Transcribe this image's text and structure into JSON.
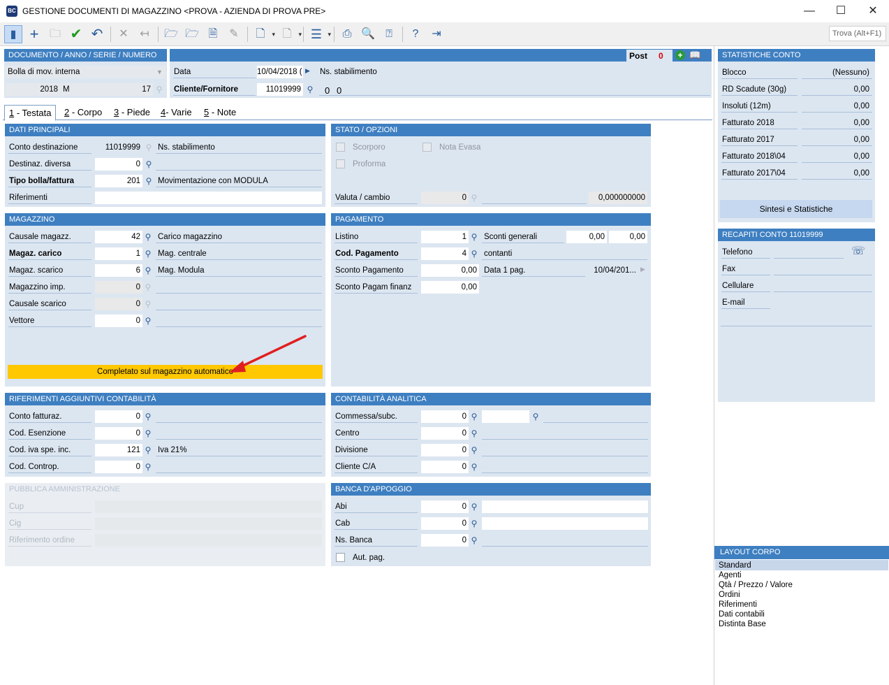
{
  "window": {
    "title": "GESTIONE DOCUMENTI DI MAGAZZINO <PROVA - AZIENDA DI PROVA PRE>",
    "app_icon_text": "BC",
    "minimize": "—",
    "maximize": "☐",
    "close": "✕"
  },
  "toolbar": {
    "find_placeholder": "Trova (Alt+F1)"
  },
  "doc_header": {
    "title": "DOCUMENTO / ANNO / SERIE / NUMERO",
    "doc_type": "Bolla di mov. interna",
    "year": "2018",
    "series": "M",
    "number": "17"
  },
  "top_panel": {
    "post_label": "Post",
    "post_value": "0",
    "date_label": "Data",
    "date_value": "10/04/2018 (",
    "ns_stabilimento": "Ns. stabilimento",
    "cliente_label": "Cliente/Fornitore",
    "cliente_value": "11019999",
    "zero_a": "0",
    "zero_b": "0"
  },
  "tabs": [
    {
      "key": "1",
      "label": " - Testata"
    },
    {
      "key": "2",
      "label": " - Corpo"
    },
    {
      "key": "3",
      "label": " - Piede"
    },
    {
      "key": "4",
      "label": "- Varie"
    },
    {
      "key": "5",
      "label": " - Note"
    }
  ],
  "dati_principali": {
    "title": "DATI PRINCIPALI",
    "conto_destinazione_label": "Conto destinazione",
    "conto_destinazione_value": "11019999",
    "conto_destinazione_desc": "Ns. stabilimento",
    "destinaz_label": "Destinaz. diversa",
    "destinaz_value": "0",
    "tipo_bolla_label": "Tipo bolla/fattura",
    "tipo_bolla_value": "201",
    "tipo_bolla_desc": "Movimentazione con MODULA",
    "riferimenti_label": "Riferimenti"
  },
  "stato_opzioni": {
    "title": "STATO / OPZIONI",
    "scorporo": "Scorporo",
    "nota_evasa": "Nota Evasa",
    "proforma": "Proforma",
    "valuta_label": "Valuta / cambio",
    "valuta_value": "0",
    "cambio_value": "0,000000000"
  },
  "magazzino": {
    "title": "MAGAZZINO",
    "rows": [
      {
        "label": "Causale magazz.",
        "value": "42",
        "desc": "Carico magazzino",
        "bold": false,
        "ro": false
      },
      {
        "label": "Magaz. carico",
        "value": "1",
        "desc": "Mag. centrale",
        "bold": true,
        "ro": false
      },
      {
        "label": "Magaz. scarico",
        "value": "6",
        "desc": "Mag. Modula",
        "bold": false,
        "ro": false
      },
      {
        "label": "Magazzino imp.",
        "value": "0",
        "desc": "",
        "bold": false,
        "ro": true
      },
      {
        "label": "Causale scarico",
        "value": "0",
        "desc": "",
        "bold": false,
        "ro": true
      },
      {
        "label": "Vettore",
        "value": "0",
        "desc": "",
        "bold": false,
        "ro": false
      }
    ],
    "status_bar": "Completato sul magazzino automatico"
  },
  "pagamento": {
    "title": "PAGAMENTO",
    "listino_label": "Listino",
    "listino_value": "1",
    "sconti_generali_label": "Sconti generali",
    "sconto_1": "0,00",
    "sconto_2": "0,00",
    "cod_pag_label": "Cod. Pagamento",
    "cod_pag_value": "4",
    "cod_pag_desc": "contanti",
    "sconto_pag_label": "Sconto Pagamento",
    "sconto_pag_value": "0,00",
    "data_1_pag_label": "Data 1 pag.",
    "data_1_pag_value": "10/04/201...",
    "sconto_finanz_label": "Sconto Pagam finanz",
    "sconto_finanz_value": "0,00"
  },
  "rif_contabilita": {
    "title": "RIFERIMENTI AGGIUNTIVI CONTABILITÀ",
    "rows": [
      {
        "label": "Conto fatturaz.",
        "value": "0",
        "desc": ""
      },
      {
        "label": "Cod. Esenzione",
        "value": "0",
        "desc": ""
      },
      {
        "label": "Cod. iva spe. inc.",
        "value": "121",
        "desc": "Iva 21%"
      },
      {
        "label": "Cod. Controp.",
        "value": "0",
        "desc": ""
      }
    ]
  },
  "contabilita_analitica": {
    "title": "CONTABILITÀ ANALITICA",
    "rows": [
      {
        "label": "Commessa/subc.",
        "value": "0"
      },
      {
        "label": "Centro",
        "value": "0"
      },
      {
        "label": "Divisione",
        "value": "0"
      },
      {
        "label": "Cliente C/A",
        "value": "0"
      }
    ]
  },
  "pubblica_amm": {
    "title": "PUBBLICA AMMINISTRAZIONE",
    "rows": [
      "Cup",
      "Cig",
      "Riferimento ordine"
    ]
  },
  "banca": {
    "title": "BANCA D'APPOGGIO",
    "rows": [
      {
        "label": "Abi",
        "value": "0"
      },
      {
        "label": "Cab",
        "value": "0"
      },
      {
        "label": "Ns. Banca",
        "value": "0"
      }
    ],
    "aut_pag": "Aut. pag."
  },
  "statistiche": {
    "title": "STATISTICHE CONTO",
    "rows": [
      {
        "label": "Blocco",
        "value": "(Nessuno)"
      },
      {
        "label": "RD Scadute (30g)",
        "value": "0,00"
      },
      {
        "label": "Insoluti (12m)",
        "value": "0,00"
      },
      {
        "label": "Fatturato 2018",
        "value": "0,00"
      },
      {
        "label": "Fatturato 2017",
        "value": "0,00"
      },
      {
        "label": "Fatturato 2018\\04",
        "value": "0,00"
      },
      {
        "label": "Fatturato 2017\\04",
        "value": "0,00"
      }
    ],
    "button": "Sintesi e Statistiche"
  },
  "recapiti": {
    "title": "RECAPITI CONTO 11019999",
    "rows": [
      "Telefono",
      "Fax",
      "Cellulare",
      "E-mail"
    ]
  },
  "layout_corpo": {
    "title": "LAYOUT CORPO",
    "items": [
      "Standard",
      "Agenti",
      "Qtà / Prezzo / Valore",
      "Ordini",
      "Riferimenti",
      "Dati contabili",
      "Distinta Base"
    ],
    "selected": "Standard"
  },
  "colors": {
    "panel_header": "#3e7fc1",
    "panel_bg": "#dce6f1",
    "status_yellow": "#ffc800",
    "annotation_arrow": "#e02020",
    "post_red": "#d40000"
  }
}
